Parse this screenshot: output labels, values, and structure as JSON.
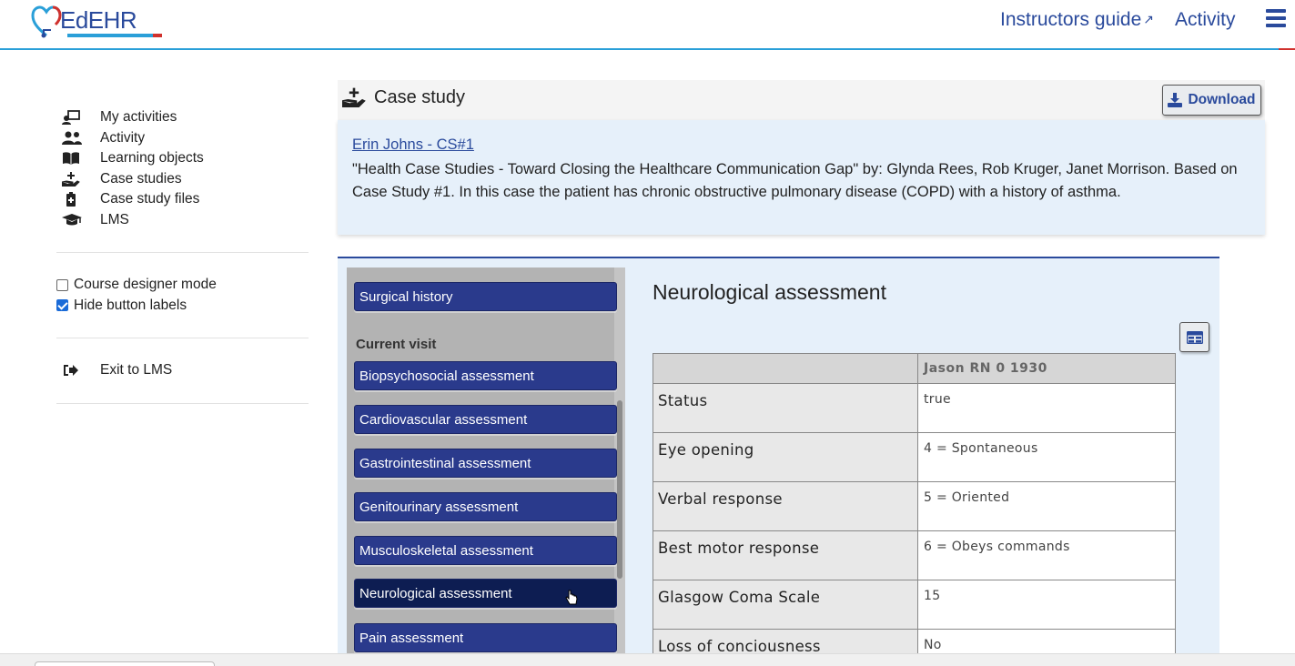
{
  "header": {
    "logo_text": "EdEHR",
    "guide_link": "Instructors guide",
    "activity_link": "Activity",
    "brand_colors": {
      "primary": "#2a4a9c",
      "accent": "#2a9fd8",
      "red": "#d0312d"
    }
  },
  "sidebar": {
    "items": [
      {
        "label": "My activities",
        "icon": "activities-icon"
      },
      {
        "label": "Activity",
        "icon": "users-icon"
      },
      {
        "label": "Learning objects",
        "icon": "book-icon"
      },
      {
        "label": "Case studies",
        "icon": "hand-plus-icon"
      },
      {
        "label": "Case study files",
        "icon": "clipboard-icon"
      },
      {
        "label": "LMS",
        "icon": "graduation-cap-icon"
      }
    ],
    "course_designer_mode": {
      "label": "Course designer mode",
      "checked": false
    },
    "hide_button_labels": {
      "label": "Hide button labels",
      "checked": true
    },
    "exit_label": "Exit to LMS"
  },
  "case_study": {
    "header": "Case study",
    "download_label": "Download",
    "link_text": "Erin Johns - CS#1",
    "description": "\"Health Case Studies - Toward Closing the Healthcare Communication Gap\" by: Glynda Rees, Rob Kruger, Janet Morrison. Based on Case Study #1. In this case the patient has chronic obstructive pulmonary disease (COPD) with a history of asthma."
  },
  "ehr_nav": {
    "top_item": "Surgical history",
    "section_label": "Current visit",
    "items": [
      "Biopsychosocial assessment",
      "Cardiovascular assessment",
      "Gastrointestinal assessment",
      "Genitourinary assessment",
      "Musculoskeletal assessment",
      "Neurological assessment",
      "Pain assessment"
    ],
    "active": "Neurological assessment"
  },
  "assessment": {
    "title": "Neurological assessment",
    "column_header": "Jason RN 0 1930",
    "rows": [
      {
        "label": "Status",
        "value": "true"
      },
      {
        "label": "Eye opening",
        "value": "4 = Spontaneous"
      },
      {
        "label": "Verbal response",
        "value": "5 = Oriented"
      },
      {
        "label": "Best motor response",
        "value": "6 = Obeys commands"
      },
      {
        "label": "Glasgow Coma Scale",
        "value": "15"
      },
      {
        "label": "Loss of conciousness",
        "value": "No"
      }
    ]
  }
}
